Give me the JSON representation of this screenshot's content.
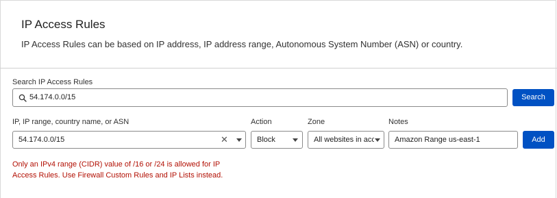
{
  "header": {
    "title": "IP Access Rules",
    "description": "IP Access Rules can be based on IP address, IP address range, Autonomous System Number (ASN) or country."
  },
  "search": {
    "label": "Search IP Access Rules",
    "value": "54.174.0.0/15",
    "button_label": "Search"
  },
  "form": {
    "ip_label": "IP, IP range, country name, or ASN",
    "ip_value": "54.174.0.0/15",
    "action_label": "Action",
    "action_value": "Block",
    "zone_label": "Zone",
    "zone_value": "All websites in account",
    "notes_label": "Notes",
    "notes_value": "Amazon Range us-east-1",
    "add_label": "Add"
  },
  "error": {
    "message": "Only an IPv4 range (CIDR) value of /16 or /24 is allowed for IP Access Rules. Use Firewall Custom Rules and IP Lists instead."
  },
  "colors": {
    "accent": "#0051c3",
    "error": "#b20f03"
  },
  "icons": {
    "search": "search-icon",
    "clear": "close-icon",
    "dropdown": "chevron-down-icon"
  }
}
